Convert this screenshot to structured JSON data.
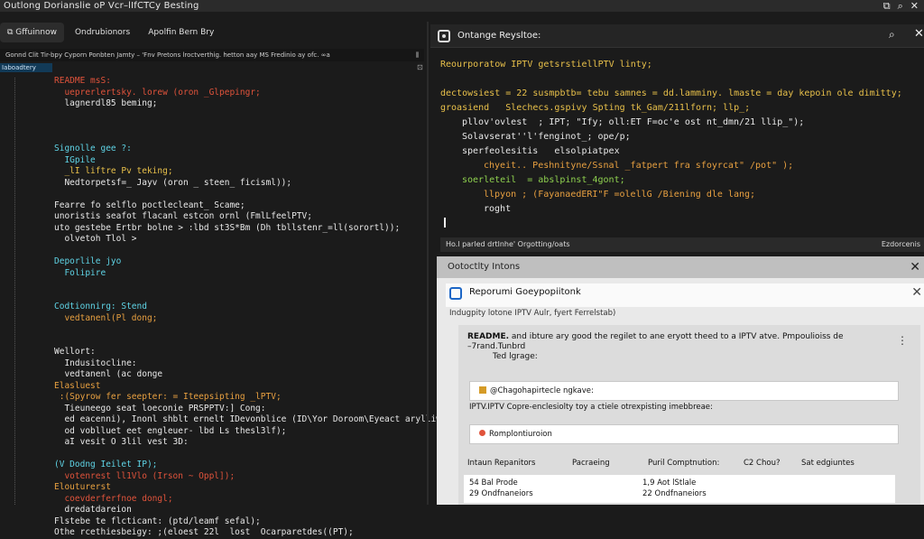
{
  "window": {
    "title": "Outlong Dorianslie oP Vcr–lIfCTCy Besting"
  },
  "editor": {
    "tabs": [
      {
        "label": "⧉ Gffuinnow",
        "active": true
      },
      {
        "label": "Ondrubionors",
        "active": false
      },
      {
        "label": "Apolfin Bern Bry",
        "active": false
      }
    ],
    "breadcrumb": "Gonnd Clit Tir-bpy   Cyporn Ponbten Jamty – 'Fnv Pretons lroctverthig. hetton aay MS Fredinio ay ofc. ∞a",
    "sidebar_label": "Iaboadtery",
    "lines": [
      {
        "text": "README msS:",
        "color": "red"
      },
      {
        "text": "  ueprerlertsky. lorew (oron _Glpepingr;",
        "color": "red"
      },
      {
        "text": "  lagnerdl85 beming;",
        "color": "wht"
      },
      {
        "text": "",
        "color": "wht"
      },
      {
        "text": "",
        "color": "wht"
      },
      {
        "text": "",
        "color": "wht"
      },
      {
        "text": "Signolle gee ?:",
        "color": "cyn"
      },
      {
        "text": "  IGpile",
        "color": "cyn"
      },
      {
        "text": "  _lI liftre Pv teking;",
        "color": "yel"
      },
      {
        "text": "  Nedtorpetsf=_ Jayv (oron _ steen_ ficisml));",
        "color": "wht"
      },
      {
        "text": "",
        "color": "wht"
      },
      {
        "text": "Fearre fo selflo poctlecleant_ Scame;",
        "color": "wht"
      },
      {
        "text": "unoristis seafot flacanl estcon ornl (FmlLfeelPTV;",
        "color": "wht"
      },
      {
        "text": "uto gestebe Ertbr bolne > :lbd st3S*Bm (Dh tbllstenr_=ll(sorortl));",
        "color": "wht"
      },
      {
        "text": "  olvetoh Tlol >",
        "color": "wht"
      },
      {
        "text": "",
        "color": "wht"
      },
      {
        "text": "Deporlile jyo",
        "color": "cyn"
      },
      {
        "text": "  Folipire",
        "color": "cyn"
      },
      {
        "text": "",
        "color": "wht"
      },
      {
        "text": "",
        "color": "wht"
      },
      {
        "text": "Codtionnirg: Stend",
        "color": "cyn"
      },
      {
        "text": "  vedtanenl(Pl dong;",
        "color": "org"
      },
      {
        "text": "",
        "color": "wht"
      },
      {
        "text": "",
        "color": "wht"
      },
      {
        "text": "Wellort:",
        "color": "wht"
      },
      {
        "text": "  Indusitocline:",
        "color": "wht"
      },
      {
        "text": "  vedtanenl (ac donge",
        "color": "wht"
      },
      {
        "text": "Elasluest",
        "color": "org"
      },
      {
        "text": " :(Spyrow fer seepter: = Iteepsipting _lPTV;",
        "color": "org"
      },
      {
        "text": "  Tieuneego seat loeconie PRSPPTV:] Cong:",
        "color": "wht"
      },
      {
        "text": "  ed eacenni), Inonl shblt ernelt IDevonblice (ID\\Yor Doroom\\Eyeact arylliwnt",
        "color": "wht"
      },
      {
        "text": "  od voblluet eet engleuer- lbd Ls thesl3lf);",
        "color": "wht"
      },
      {
        "text": "  aI vesit O 3lil vest 3D:",
        "color": "wht"
      },
      {
        "text": "",
        "color": "wht"
      },
      {
        "text": "(V Dodng Ieilet IP);",
        "color": "cyn"
      },
      {
        "text": "  votenrest ll1Vlo (Irson ~ Oppl]);",
        "color": "red"
      },
      {
        "text": "Elouturerst",
        "color": "org"
      },
      {
        "text": "  coevderferfnoe dongl;",
        "color": "red"
      },
      {
        "text": "  dredatdareion",
        "color": "wht"
      },
      {
        "text": "Flstebe te flcticant: (ptd/leamf sefal);",
        "color": "wht"
      },
      {
        "text": "Othe rcethiesbeigy: ;(eloest 22l  lost  Ocarparetdes((PT);",
        "color": "wht"
      }
    ]
  },
  "right_pane": {
    "title": "Ontange Reysltoe:",
    "lines": [
      {
        "text": "Reourporatow IPTV getsrstiellPTV linty;",
        "color": "yel",
        "indent": 0
      },
      {
        "text": "",
        "color": "wht",
        "indent": 0
      },
      {
        "text": "dectowsiest = 22 susmpbtb= tebu samnes = dd.lamminy. lmaste = day kepoin ole dimitty;",
        "color": "yel",
        "indent": 0
      },
      {
        "text": "groasiend   Slechecs.gspivy Spting tk_Gam/211lforn; llp_;",
        "color": "yel",
        "indent": 0
      },
      {
        "text": "pllov'ovlest  ; IPT; \"Ify; oll:ET F=oc'e ost nt_dmn/21 llip_\");",
        "color": "wht",
        "indent": 2
      },
      {
        "text": "Solavserat''l'fenginot_; ope/p;",
        "color": "wht",
        "indent": 2
      },
      {
        "text": "sperfeolesitis   elsolpiatpex",
        "color": "wht",
        "indent": 2
      },
      {
        "text": "chyeit.. Peshnityne/Ssnal _fatpert fra sfoyrcat\" /pot\" );",
        "color": "org",
        "indent": 4
      },
      {
        "text": "soerleteil  = abslpinst_4gont;",
        "color": "grn",
        "indent": 2
      },
      {
        "text": "llpyon ; (FayanaedERI\"F =olellG /Biening dle lang;",
        "color": "org",
        "indent": 4
      },
      {
        "text": "roght",
        "color": "wht",
        "indent": 4
      }
    ],
    "status_left": "Ho.l parled drtlnhe' Orgotting/oats",
    "status_right": "Ezdorcenis"
  },
  "panel": {
    "title": "Ootoctlty Intons",
    "card_title": "Reporumi Goeypopiitonk",
    "subtitle": "Indugpity lotone IPTV Aulr, fyert Ferrelstab)",
    "readme_bold": "README.",
    "readme_rest": " and ibture ary good the regilet to ane eryott theed to a IPTV atve. Pmpoulioiss de –7rand.Tunbrd",
    "readme_sub": "Ted lgrage:",
    "input1": "@Chagohapirtecle ngkave:",
    "label2": "IPTV.IPTV Copre-enclesiolty toy a ctiele otrexpisting imebbreae:",
    "input2": "Romplontiuroion",
    "table_headers": [
      "Intaun Repanitors",
      "Pacraeing",
      "Puril Comptnution:",
      "C2 Chou?",
      "Sat edgiuntes"
    ],
    "rows": [
      [
        "54 Bal Prode",
        "1,9 Aot lStlale"
      ],
      [
        "29 Ondfnaneiors",
        "22 Ondfnaneiors"
      ]
    ]
  },
  "colors": {
    "red": "#e0533b",
    "yellow": "#e8c04a",
    "cyan": "#5fd4e6",
    "green": "#8fd14f",
    "orange": "#e8a040"
  }
}
